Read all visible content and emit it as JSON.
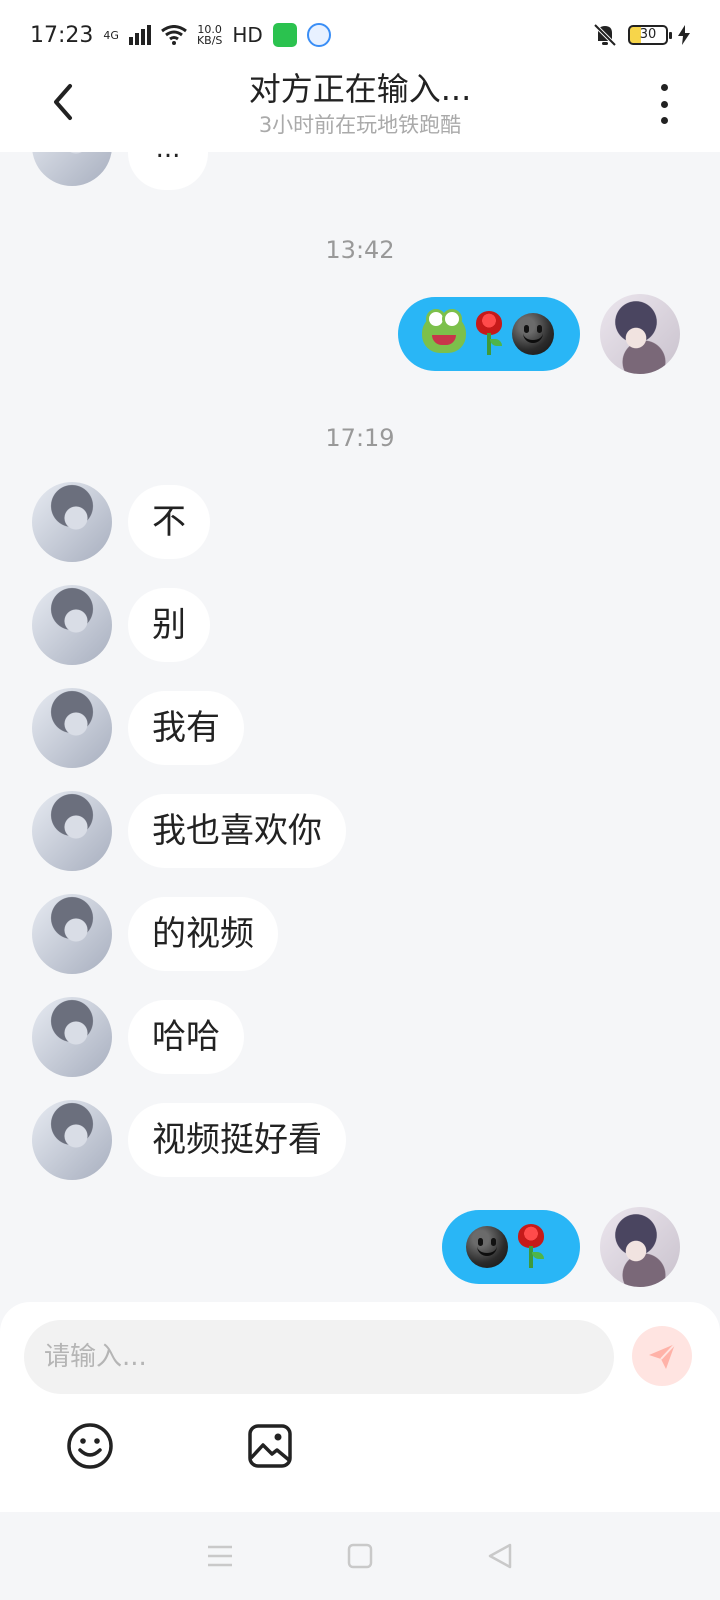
{
  "status_bar": {
    "time": "17:23",
    "network": "4G",
    "speed_value": "10.0",
    "speed_unit": "KB/S",
    "hd": "HD",
    "battery": "30",
    "icons": [
      "signal-icon",
      "wifi-icon",
      "wechat-icon",
      "app-icon",
      "mute-icon",
      "battery-icon",
      "charging-icon"
    ]
  },
  "header": {
    "title": "对方正在输入...",
    "subtitle": "3小时前在玩地铁跑酷"
  },
  "chat": {
    "partial_message": "...",
    "timestamps": [
      "13:42",
      "17:19"
    ],
    "messages_other": [
      {
        "text": "不"
      },
      {
        "text": "别"
      },
      {
        "text": "我有"
      },
      {
        "text": "我也喜欢你"
      },
      {
        "text": "的视频"
      },
      {
        "text": "哈哈"
      },
      {
        "text": "视频挺好看"
      }
    ],
    "messages_me": [
      {
        "emojis": [
          "frog-emoji",
          "rose-emoji",
          "dark-smile-emoji"
        ]
      },
      {
        "emojis": [
          "dark-smile-emoji",
          "rose-emoji"
        ]
      }
    ]
  },
  "input": {
    "placeholder": "请输入..."
  },
  "colors": {
    "my_bubble": "#29b6f6",
    "other_bubble": "#ffffff",
    "background": "#f5f6f8",
    "send_button": "#ffe4e1",
    "send_icon": "#ffb2a8"
  }
}
